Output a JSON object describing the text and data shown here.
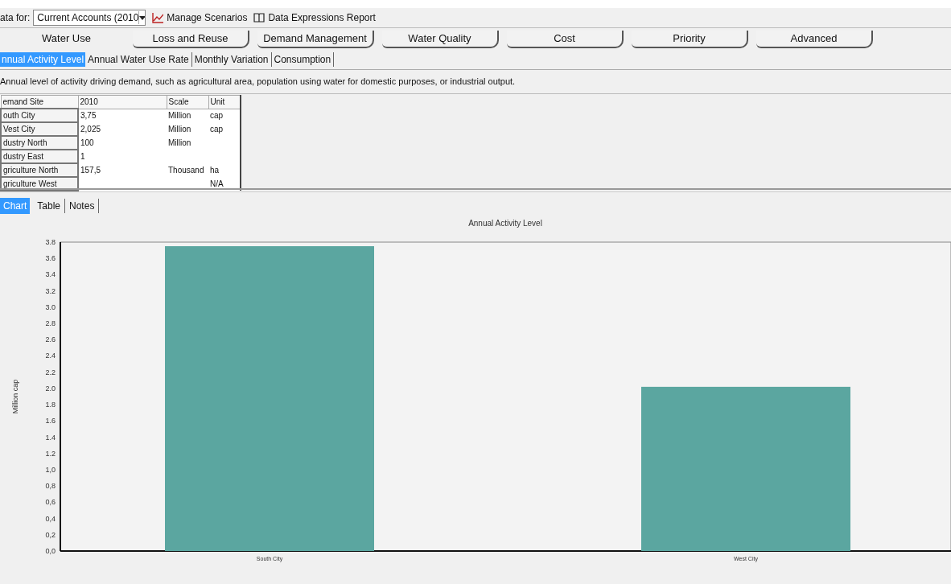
{
  "toolbar": {
    "data_for_label": "ata for:",
    "scenario": "Current Accounts (2010",
    "manage_scenarios": "Manage Scenarios",
    "report": "Data Expressions Report"
  },
  "main_tabs": [
    {
      "label": "Water Use",
      "selected": true
    },
    {
      "label": "Loss and Reuse",
      "selected": false
    },
    {
      "label": "Demand Management",
      "selected": false
    },
    {
      "label": "Water Quality",
      "selected": false
    },
    {
      "label": "Cost",
      "selected": false
    },
    {
      "label": "Priority",
      "selected": false
    },
    {
      "label": "Advanced",
      "selected": false
    }
  ],
  "sub_tabs": [
    {
      "label": "nnual Activity Level",
      "selected": true
    },
    {
      "label": "Annual Water Use Rate",
      "selected": false
    },
    {
      "label": "Monthly Variation",
      "selected": false
    },
    {
      "label": "Consumption",
      "selected": false
    }
  ],
  "description": "Annual level of activity driving demand, such as agricultural area, population using water for domestic purposes, or industrial output.",
  "table": {
    "columns": [
      "emand Site",
      "2010",
      "Scale",
      "Unit"
    ],
    "rows": [
      [
        "outh City",
        "3,75",
        "Million",
        "cap"
      ],
      [
        "Vest City",
        "2,025",
        "Million",
        "cap"
      ],
      [
        "dustry North",
        "100",
        "Million",
        ""
      ],
      [
        "dustry East",
        "1",
        "",
        ""
      ],
      [
        "griculture North",
        "157,5",
        "Thousand",
        "ha"
      ],
      [
        "griculture West",
        "",
        "",
        "N/A"
      ]
    ]
  },
  "view_tabs": [
    {
      "label": "Chart",
      "selected": true
    },
    {
      "label": "Table",
      "selected": false
    },
    {
      "label": "Notes",
      "selected": false
    }
  ],
  "chart_data": {
    "type": "bar",
    "title": "Annual Activity Level",
    "ylabel": "Million cap",
    "categories": [
      "South City",
      "West City"
    ],
    "series": [
      {
        "color": "#5ba6a0",
        "values": [
          3.75,
          2.02
        ]
      }
    ],
    "ylim": [
      0,
      3.8
    ],
    "yticks": [
      {
        "value": 0,
        "label": "0,0"
      },
      {
        "value": 0.2,
        "label": "0,2"
      },
      {
        "value": 0.4,
        "label": "0,4"
      },
      {
        "value": 0.6,
        "label": "0,6"
      },
      {
        "value": 0.8,
        "label": "0,8"
      },
      {
        "value": 1,
        "label": "1,0"
      },
      {
        "value": 1.2,
        "label": "1.2"
      },
      {
        "value": 1.4,
        "label": "1.4"
      },
      {
        "value": 1.6,
        "label": "1.6"
      },
      {
        "value": 1.8,
        "label": "1.8"
      },
      {
        "value": 2,
        "label": "2.0"
      },
      {
        "value": 2.2,
        "label": "2.2"
      },
      {
        "value": 2.4,
        "label": "2.4"
      },
      {
        "value": 2.6,
        "label": "2.6"
      },
      {
        "value": 2.8,
        "label": "2.8"
      },
      {
        "value": 3,
        "label": "3.0"
      },
      {
        "value": 3.2,
        "label": "3.2"
      },
      {
        "value": 3.4,
        "label": "3.4"
      },
      {
        "value": 3.6,
        "label": "3.6"
      },
      {
        "value": 3.8,
        "label": "3.8"
      }
    ]
  }
}
